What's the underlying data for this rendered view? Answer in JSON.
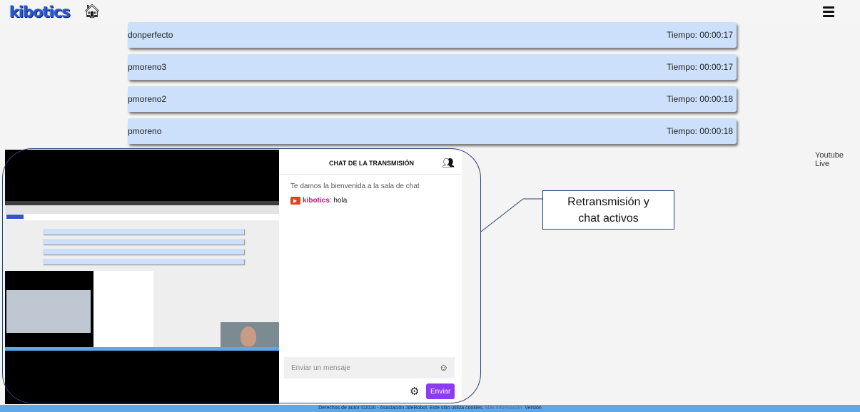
{
  "header": {
    "logo_text": "kibotics",
    "home_icon": "home-icon",
    "menu_icon": "menu-icon"
  },
  "sessions": [
    {
      "user": "donperfecto",
      "time": "Tiempo: 00:00:17"
    },
    {
      "user": "pmoreno3",
      "time": "Tiempo: 00:00:17"
    },
    {
      "user": "pmoreno2",
      "time": "Tiempo: 00:00:18"
    },
    {
      "user": "pmoreno",
      "time": "Tiempo: 00:00:18"
    }
  ],
  "youtube_label": "Youtube Live",
  "chat": {
    "title": "CHAT DE LA TRANSMISIÓN",
    "welcome": "Te damos la bienvenida a la sala de chat",
    "messages": [
      {
        "author": "kibotics",
        "text": "hola"
      }
    ],
    "input_placeholder": "Enviar un mensaje",
    "send_label": "Enviar"
  },
  "annotation": {
    "line1": "Retransmisión y",
    "line2": "chat activos"
  },
  "footer": {
    "text": "Derechos de autor ©2020 - Asociación JdeRobot. Este sitio utiliza cookies.",
    "more_info": "Más Información.",
    "version": "Versión"
  },
  "colors": {
    "row_bg": "#cde0fb",
    "send_button": "#8b3cf0",
    "footer_bg": "#5ea7e8",
    "annotation_border": "#2b4272"
  }
}
